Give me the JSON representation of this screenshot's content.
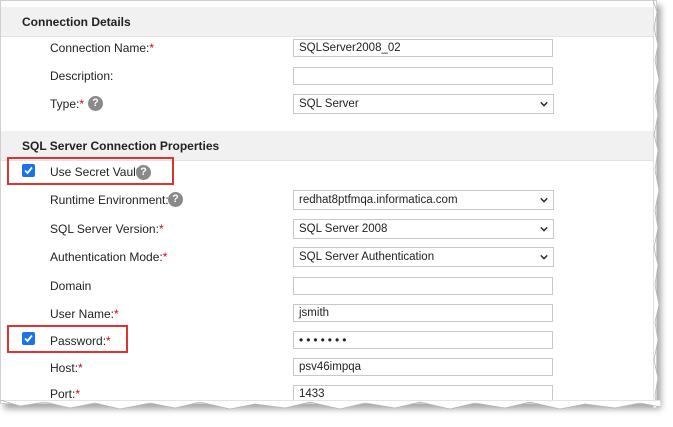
{
  "sections": {
    "connection_details": "Connection Details",
    "sql_server_props": "SQL Server Connection Properties"
  },
  "fields": {
    "connection_name": {
      "label": "Connection Name:",
      "required": "*",
      "value": "SQLServer2008_02"
    },
    "description": {
      "label": "Description:",
      "value": ""
    },
    "type": {
      "label": "Type:",
      "required": "*",
      "value": "SQL Server"
    },
    "use_secret_vault": {
      "label": "Use Secret Vault",
      "checked": true
    },
    "runtime_environment": {
      "label": "Runtime Environment:",
      "required": "*",
      "value": "redhat8ptfmqa.informatica.com"
    },
    "sql_server_version": {
      "label": "SQL Server Version:",
      "required": "*",
      "value": "SQL Server 2008"
    },
    "authentication_mode": {
      "label": "Authentication Mode:",
      "required": "*",
      "value": "SQL Server Authentication"
    },
    "domain": {
      "label": "Domain",
      "value": ""
    },
    "user_name": {
      "label": "User Name:",
      "required": "*",
      "value": "jsmith"
    },
    "password": {
      "label": "Password:",
      "required": "*",
      "value": "•••••••",
      "checked": true
    },
    "host": {
      "label": "Host:",
      "required": "*",
      "value": "psv46impqa"
    },
    "port": {
      "label": "Port:",
      "required": "*",
      "value": "1433"
    }
  },
  "icons": {
    "help": "question-mark-circle-icon",
    "dropdown": "chevron-down-icon",
    "checkbox": "checkmark-icon"
  },
  "colors": {
    "required": "#d4001a",
    "checkbox": "#1a73e8",
    "highlight": "#e0322f"
  }
}
